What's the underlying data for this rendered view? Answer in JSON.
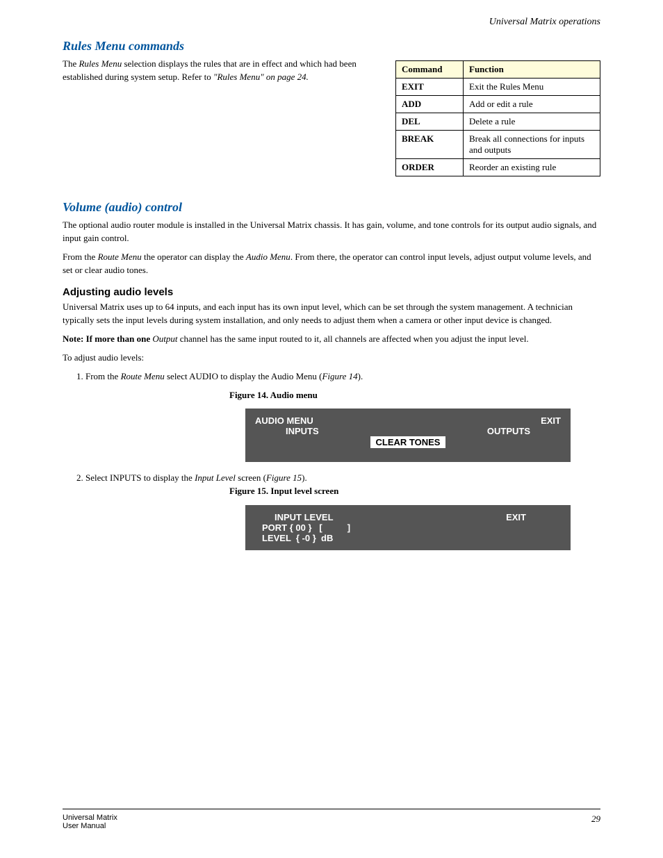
{
  "header_right": "Universal Matrix operations",
  "sec1": {
    "title": "Rules Menu commands",
    "intro": "The ",
    "intro_link": "Rules Menu",
    "intro2": " selection displays the rules that are in effect and which had been established during system setup. Refer to ",
    "intro_link2": "\"Rules Menu\" on page 24.",
    "table_col1": "Command",
    "table_col2": "Function",
    "rows": [
      {
        "c": "EXIT",
        "f": "Exit the Rules Menu"
      },
      {
        "c": "ADD",
        "f": "Add or edit a rule"
      },
      {
        "c": "DEL",
        "f": "Delete a rule"
      },
      {
        "c": "BREAK",
        "f": "Break all connections for inputs and outputs"
      },
      {
        "c": "ORDER",
        "f": "Reorder an existing rule"
      }
    ]
  },
  "sec2": {
    "title": "Volume (audio) control",
    "p1": "The optional audio router module is installed in the Universal Matrix chassis. It has gain, volume, and tone controls for its output audio signals, and input gain control.",
    "p2a": "From the ",
    "p2_link1": "Route Menu",
    "p2b": " the operator can display the ",
    "p2_link2": "Audio Menu",
    "p2c": ". From there, the operator can control input levels, adjust output volume levels, and set or clear audio tones.",
    "h1": "Adjusting audio levels",
    "p3": "Universal Matrix uses up to 64 inputs, and each input has its own input level, which can be set through the system management. A technician typically sets the input levels during system installation, and only needs to adjust them when a camera or other input device is changed.",
    "p4a": "Note: If more than one ",
    "p4b": " channel has the same input routed to it, all channels are affected when you adjust the input level.",
    "p5": "To adjust audio levels:",
    "li1a": "1. From the ",
    "li1_link": "Route Menu",
    "li1b": " select AUDIO to display the Audio Menu (",
    "li1_link2": "Figure 14",
    "li1c": ").",
    "fig14": "Figure 14.  Audio menu",
    "osd1": {
      "t": "AUDIO MENU",
      "e": "EXIT",
      "l": "INPUTS",
      "r": "OUTPUTS",
      "c": "CLEAR TONES"
    },
    "li2a": "2. Select INPUTS to display the ",
    "li2_link": "Input Level",
    "li2b": " screen (",
    "li2_link2": "Figure 15",
    "li2c": ").",
    "fig15": "Figure 15.  Input level screen",
    "osd2": {
      "t": "INPUT LEVEL",
      "e": "EXIT",
      "p": "PORT { 00 }   [          ]",
      "lv": "LEVEL  { -0 }  dB"
    }
  },
  "footer": {
    "left": "Universal Matrix\nUser Manual",
    "right": "29"
  }
}
